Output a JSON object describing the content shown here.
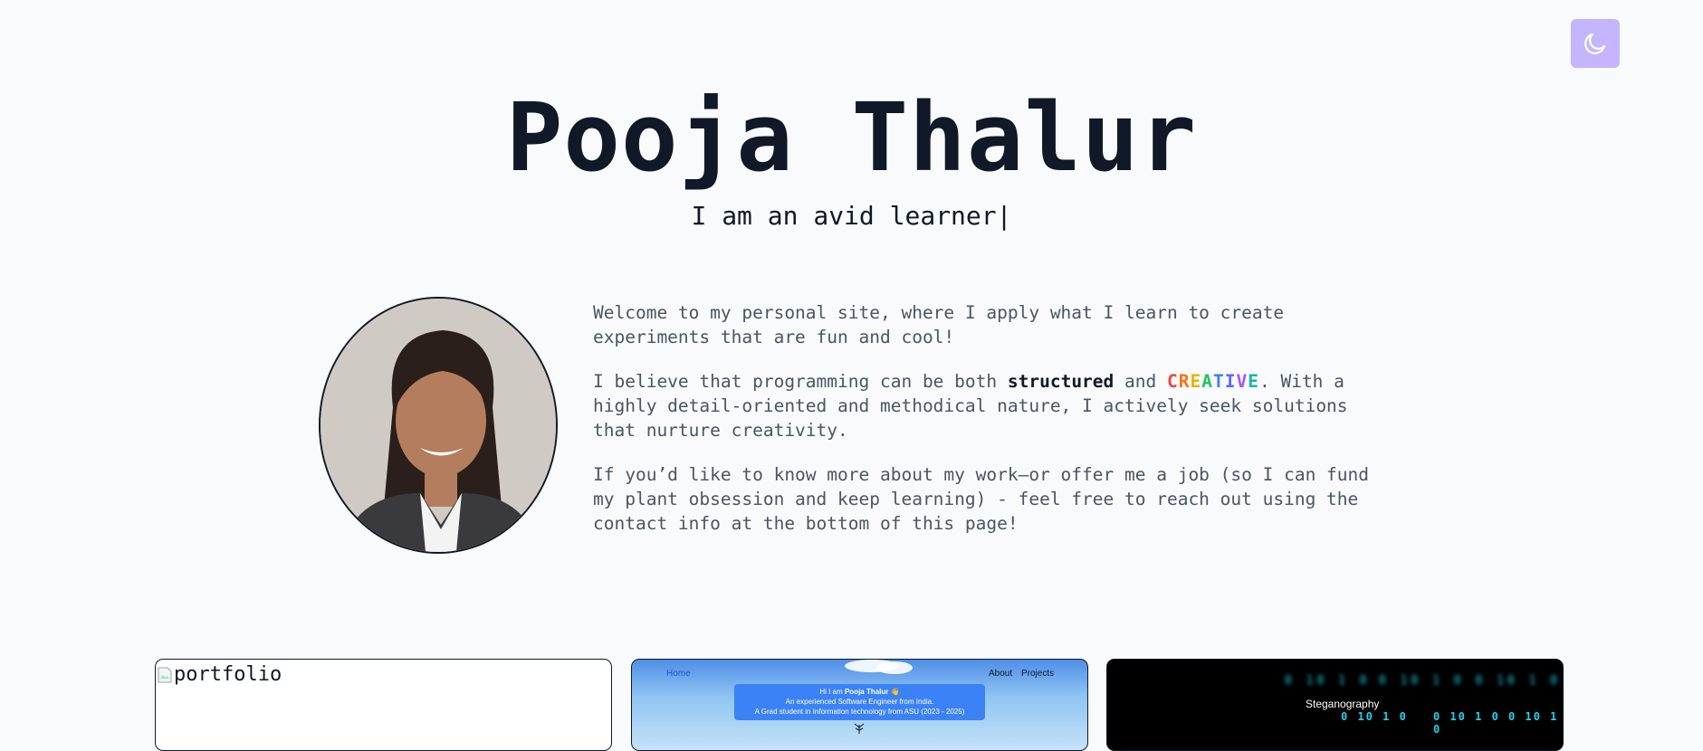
{
  "header": {
    "theme_toggle_icon": "moon-icon",
    "name": "Pooja Thalur",
    "tagline": "I am an avid learner|"
  },
  "about": {
    "avatar_alt": "profile photo",
    "p1": "Welcome to my personal site, where I apply what I learn to create experiments that are fun and cool!",
    "p2_before": "I believe that programming can be both ",
    "p2_strong": "structured",
    "p2_middle": " and ",
    "p2_creative": "CREATIVE",
    "p2_after": ". With a highly detail-oriented and methodical nature, I actively seek solutions that nurture creativity.",
    "p3": "If you’d like to know more about my work—or offer me a job (so I can fund my plant obsession and keep learning) - feel free to reach out using the contact info at the bottom of this page!"
  },
  "creative_colors": [
    "#ef4444",
    "#f97316",
    "#eab308",
    "#22c55e",
    "#3b82f6",
    "#6366f1",
    "#a855f7",
    "#14b8a6"
  ],
  "projects": [
    {
      "broken_image_alt": "portfolio"
    },
    {
      "nav_home": "Home",
      "nav_about": "About",
      "nav_projects": "Projects",
      "intro_hi": "Hi I am ",
      "intro_name": "Pooja Thalur",
      "intro_emoji": "👋",
      "intro_line2": "An experienced Software Engineer from India.",
      "intro_line3": "A Grad student in Information technology from ASU (2023 - 2025)"
    },
    {
      "title": "Steganography",
      "blur_row_1": "0 10 1 0",
      "blur_row_2": "0 10 1 0 0 10 1 0",
      "binary_row_1": "0 10 1 0",
      "binary_row_2": "0 10 1 0 0 10 1 0"
    }
  ]
}
